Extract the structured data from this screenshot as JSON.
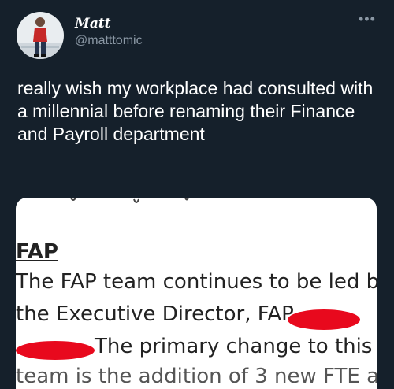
{
  "author": {
    "display_name": "Matt",
    "handle": "@matttomic"
  },
  "menu": {
    "more_label": "•••"
  },
  "tweet": {
    "text": "really wish my workplace had consulted with a millennial before renaming their Finance and Payroll department"
  },
  "document": {
    "heading": "FAP",
    "line1": "The FAP team continues to be led by",
    "line2": "the Executive Director, FAP",
    "line3": "The primary change to this",
    "line4": "team is the addition of 3 new FTE a"
  },
  "colors": {
    "background": "#15202b",
    "secondary_text": "#8b98a5",
    "redaction": "#e8091d"
  }
}
